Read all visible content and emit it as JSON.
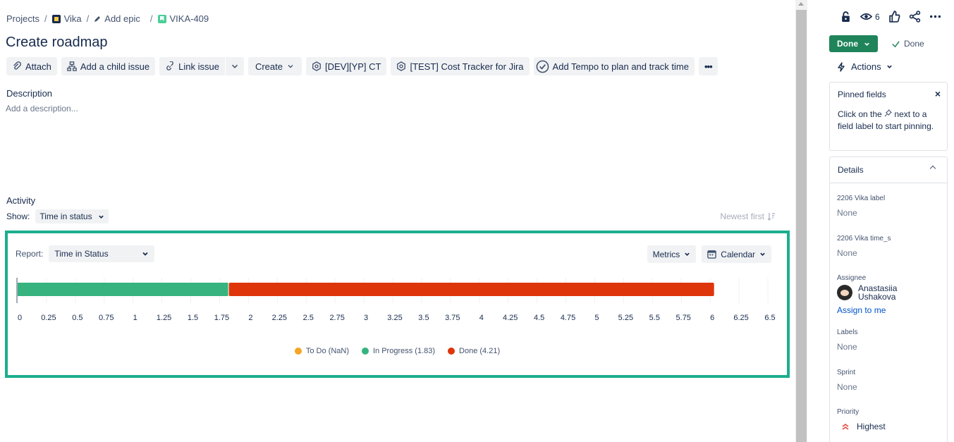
{
  "breadcrumb": {
    "projects": "Projects",
    "project": "Vika",
    "add_epic": "Add epic",
    "issue_key": "VIKA-409",
    "separator": "/"
  },
  "title": "Create roadmap",
  "toolbar": {
    "attach": "Attach",
    "add_child": "Add a child issue",
    "link_issue": "Link issue",
    "create": "Create",
    "app1": "[DEV][YP] CT",
    "app2": "[TEST] Cost Tracker for Jira",
    "tempo": "Add Tempo to plan and track time",
    "more": "•••"
  },
  "description": {
    "label": "Description",
    "placeholder": "Add a description..."
  },
  "activity": {
    "label": "Activity",
    "show_label": "Show:",
    "show_value": "Time in status",
    "sort": "Newest first"
  },
  "report": {
    "label": "Report:",
    "select_value": "Time in Status",
    "metrics": "Metrics",
    "calendar": "Calendar"
  },
  "chart_data": {
    "type": "bar",
    "orientation": "horizontal-stacked",
    "xlim": [
      0,
      6.5
    ],
    "ticks": [
      "0",
      "0.25",
      "0.5",
      "0.75",
      "1",
      "1.25",
      "1.5",
      "1.75",
      "2",
      "2.25",
      "2.5",
      "2.75",
      "3",
      "3.25",
      "3.5",
      "3.75",
      "4",
      "4.25",
      "4.5",
      "4.75",
      "5",
      "5.25",
      "5.5",
      "5.75",
      "6",
      "6.25",
      "6.5"
    ],
    "series": [
      {
        "name": "To Do",
        "value": 0,
        "color": "#f5a623",
        "legend": "To Do (NaN)"
      },
      {
        "name": "In Progress",
        "value": 1.83,
        "color": "#36b37e",
        "legend": "In Progress (1.83)"
      },
      {
        "name": "Done",
        "value": 4.21,
        "color": "#de350b",
        "legend": "Done (4.21)"
      }
    ],
    "legend_position": "bottom-center"
  },
  "right_panel": {
    "watch_count": "6",
    "status": "Done",
    "resolution": "Done",
    "actions": "Actions",
    "pinned_title": "Pinned fields",
    "pinned_close": "×",
    "pinned_text_1": "Click on the",
    "pinned_text_2": "next to a field label to start pinning.",
    "details_title": "Details",
    "fields": {
      "vika_label": {
        "label": "2206 Vika label",
        "value": "None"
      },
      "vika_time": {
        "label": "2206 Vika time_s",
        "value": "None"
      },
      "assignee": {
        "label": "Assignee",
        "first": "Anastasiia",
        "last": "Ushakova",
        "assign_to_me": "Assign to me"
      },
      "labels": {
        "label": "Labels",
        "value": "None"
      },
      "sprint": {
        "label": "Sprint",
        "value": "None"
      },
      "priority": {
        "label": "Priority",
        "value": "Highest"
      }
    }
  }
}
